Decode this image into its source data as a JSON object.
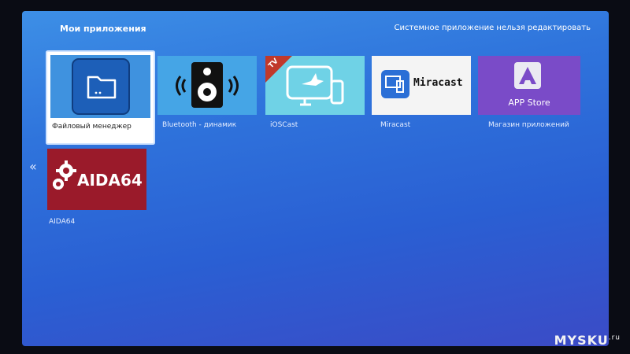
{
  "header": {
    "title": "Мои приложения",
    "note": "Системное приложение нельзя редактировать"
  },
  "nav": {
    "back_glyph": "«"
  },
  "apps": [
    {
      "name": "Файловый менеджер",
      "icon": "folder-icon",
      "selected": true
    },
    {
      "name": "Bluetooth - динамик",
      "icon": "speaker-icon"
    },
    {
      "name": "iOSCast",
      "icon": "tv-cast-icon",
      "badge": "TV"
    },
    {
      "name": "Miracast",
      "icon": "miracast-icon",
      "logo_text": "Miracast"
    },
    {
      "name": "Магазин приложений",
      "icon": "app-store-icon",
      "logo_text": "APP Store"
    },
    {
      "name": "AIDA64",
      "icon": "gears-icon",
      "logo_text": "AIDA64"
    }
  ],
  "watermark": {
    "text": "MYSKU",
    "suffix": ".ru"
  },
  "colors": {
    "screen_top": "#3d8fe6",
    "screen_bottom": "#3b4bc6",
    "aida_bg": "#9a1a2a",
    "store_bg": "#7a4bc8"
  }
}
